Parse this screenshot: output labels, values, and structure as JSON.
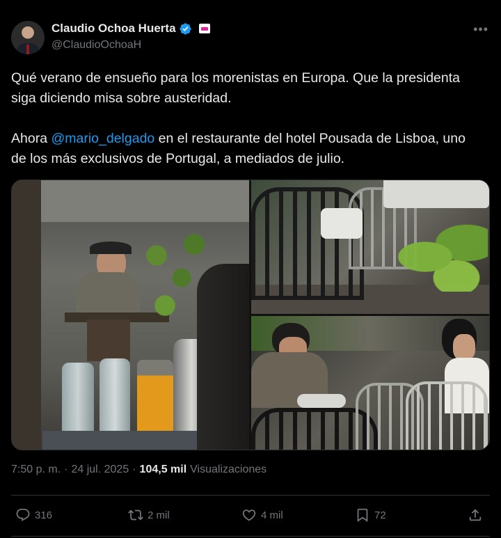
{
  "author": {
    "display_name": "Claudio Ochoa Huerta",
    "handle": "@ClaudioOchoaH",
    "verified": true
  },
  "tweet": {
    "paragraph1": "Qué verano de ensueño para los morenistas en Europa. Que la presidenta siga diciendo misa sobre austeridad.",
    "paragraph2_prefix": "Ahora ",
    "mention": "@mario_delgado",
    "paragraph2_suffix": " en el restaurante del hotel Pousada de Lisboa, uno de los más exclusivos de Portugal, a mediados de julio."
  },
  "meta": {
    "time": "7:50 p. m.",
    "separator": "·",
    "date": "24 jul. 2025",
    "views_count": "104,5 mil",
    "views_label": "Visualizaciones"
  },
  "actions": {
    "replies": "316",
    "reposts": "2 mil",
    "likes": "4 mil",
    "bookmarks": "72"
  },
  "colors": {
    "background": "#000000",
    "text": "#e7e9ea",
    "muted": "#71767b",
    "accent": "#1d9bf0",
    "border": "#2f3336"
  },
  "icons": [
    "verified-icon",
    "affiliate-badge-icon",
    "more-icon",
    "reply-icon",
    "repost-icon",
    "like-icon",
    "bookmark-icon",
    "share-icon"
  ]
}
